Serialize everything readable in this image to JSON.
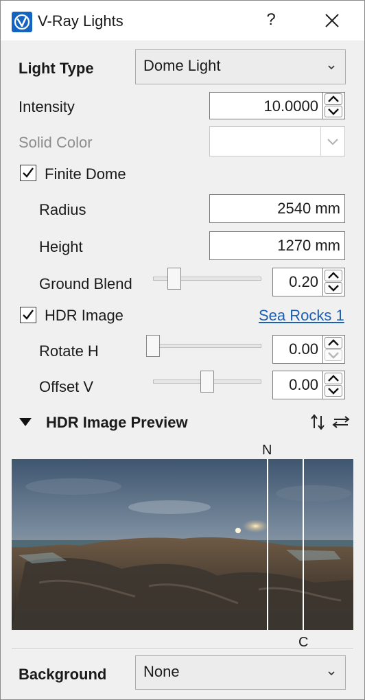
{
  "window": {
    "title": "V-Ray Lights",
    "help": "?"
  },
  "light_type": {
    "label": "Light Type",
    "value": "Dome Light"
  },
  "intensity": {
    "label": "Intensity",
    "value": "10.0000"
  },
  "solid_color": {
    "label": "Solid Color",
    "value": ""
  },
  "finite_dome": {
    "label": "Finite Dome",
    "checked": true
  },
  "radius": {
    "label": "Radius",
    "value": "2540 mm"
  },
  "height": {
    "label": "Height",
    "value": "1270 mm"
  },
  "ground_blend": {
    "label": "Ground Blend",
    "value": "0.20",
    "slider_fraction": 0.2
  },
  "hdr_image": {
    "label": "HDR Image",
    "checked": true,
    "link": "Sea Rocks 1"
  },
  "rotate_h": {
    "label": "Rotate H",
    "value": "0.00",
    "slider_fraction": 0.0
  },
  "offset_v": {
    "label": "Offset V",
    "value": "0.00",
    "slider_fraction": 0.5
  },
  "preview": {
    "section_label": "HDR Image Preview",
    "north_label": "N",
    "center_label": "C"
  },
  "background": {
    "label": "Background",
    "value": "None"
  },
  "icons": [
    "vray-logo-icon",
    "close-icon",
    "chevron-down-icon",
    "spin-up-icon",
    "spin-down-icon",
    "checkmark-icon",
    "triangle-down-icon",
    "flip-vertical-icon",
    "flip-horizontal-icon"
  ]
}
